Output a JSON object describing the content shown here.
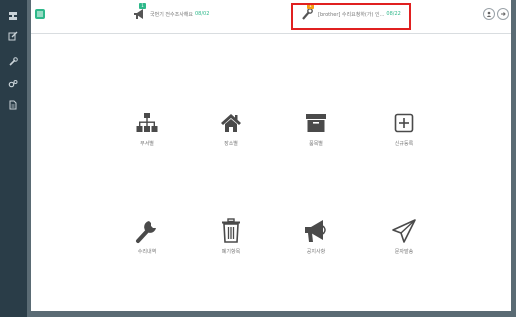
{
  "sidebar": {
    "items": [
      {
        "icon": "bookmark-icon"
      },
      {
        "icon": "edit-icon"
      },
      {
        "icon": "wrench-icon"
      },
      {
        "icon": "gears-icon"
      },
      {
        "icon": "document-icon"
      }
    ]
  },
  "topbar": {
    "notices": [
      {
        "icon": "megaphone-icon",
        "badge": "1",
        "text": "국번기 전수조사해요",
        "count": "08/02"
      },
      {
        "icon": "wrench-icon",
        "badge": "1",
        "text": "[brother] 수리요청하(가) 인...",
        "count": "08/22"
      }
    ],
    "user_icon": "user-icon",
    "logout_icon": "logout-icon"
  },
  "tiles": [
    {
      "label": "부서별",
      "icon": "org-chart-icon"
    },
    {
      "label": "장소별",
      "icon": "home-icon"
    },
    {
      "label": "품목별",
      "icon": "archive-box-icon"
    },
    {
      "label": "신규등록",
      "icon": "plus-square-icon"
    },
    {
      "label": "수리내역",
      "icon": "wrench-icon"
    },
    {
      "label": "폐기항목",
      "icon": "trash-icon"
    },
    {
      "label": "공지사항",
      "icon": "megaphone-icon"
    },
    {
      "label": "문자발송",
      "icon": "paper-plane-icon"
    }
  ],
  "colors": {
    "sidebar": "#2a3d48",
    "accent": "#2eb88a",
    "highlight": "#e02020",
    "icon": "#4a4a4a"
  }
}
